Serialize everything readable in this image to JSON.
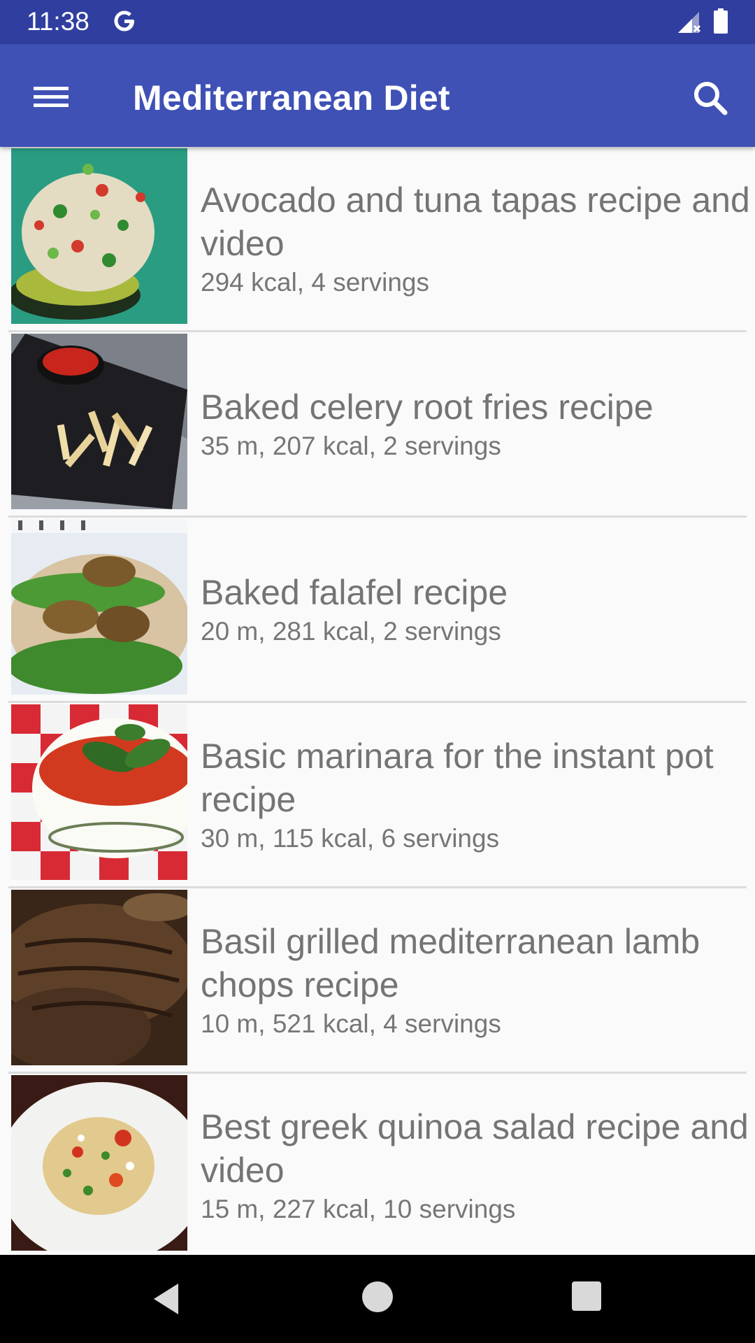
{
  "status_bar": {
    "time": "11:38",
    "g_icon": "google-g-icon",
    "signal_icon": "signal-no-data-icon",
    "battery_icon": "battery-full-icon"
  },
  "app_bar": {
    "title": "Mediterranean Diet",
    "menu_icon": "hamburger-menu-icon",
    "search_icon": "search-icon",
    "color": "#3f51b5",
    "status_color": "#303f9f"
  },
  "recipes": [
    {
      "title": "Avocado and tuna tapas recipe and video",
      "meta": "294 kcal, 4 servings"
    },
    {
      "title": "Baked celery root fries recipe",
      "meta": "35 m, 207 kcal, 2 servings"
    },
    {
      "title": "Baked falafel recipe",
      "meta": "20 m, 281 kcal, 2 servings"
    },
    {
      "title": "Basic marinara for the instant pot recipe",
      "meta": "30 m, 115 kcal, 6 servings"
    },
    {
      "title": "Basil grilled mediterranean lamb chops recipe",
      "meta": "10 m, 521 kcal, 4 servings"
    },
    {
      "title": "Best greek quinoa salad recipe and video",
      "meta": "15 m, 227 kcal, 10 servings"
    }
  ],
  "nav_bar": {
    "back_icon": "back-triangle-icon",
    "home_icon": "home-circle-icon",
    "recents_icon": "recents-square-icon"
  }
}
